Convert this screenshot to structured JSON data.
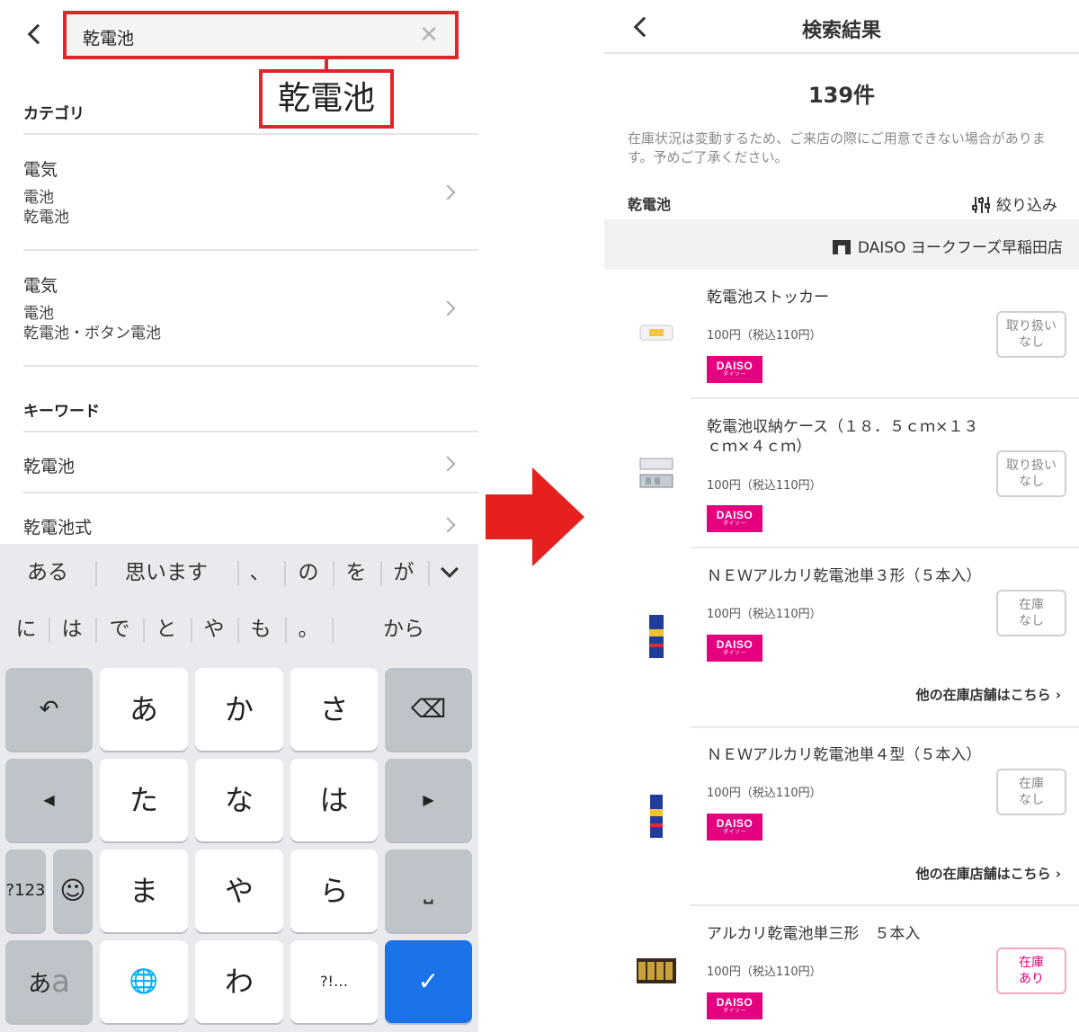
{
  "left": {
    "search": {
      "value": "乾電池",
      "clear_icon": "close-icon"
    },
    "callout_text": "乾電池",
    "category_label": "カテゴリ",
    "categories": [
      {
        "title": "電気",
        "sub1": "電池",
        "sub2": "乾電池"
      },
      {
        "title": "電気",
        "sub1": "電池",
        "sub2": "乾電池・ボタン電池"
      }
    ],
    "keyword_label": "キーワード",
    "keywords": [
      "乾電池",
      "乾電池式"
    ],
    "keyboard": {
      "suggestions_row1": [
        "ある",
        "思います",
        "、",
        "の",
        "を",
        "が"
      ],
      "suggestions_row2": [
        "に",
        "は",
        "で",
        "と",
        "や",
        "も",
        "。",
        "から"
      ],
      "keys": {
        "undo": "↶",
        "a": "あ",
        "ka": "か",
        "sa": "さ",
        "backspace": "⌫",
        "left": "◀",
        "ta": "た",
        "na": "な",
        "ha": "は",
        "right": "▶",
        "num": "?123",
        "emoji": "☺",
        "ma": "ま",
        "ya": "や",
        "ra": "ら",
        "space": "⎵",
        "mode_a": "あ",
        "mode_b": "a",
        "globe": "🌐",
        "wa": "わ",
        "punct": "?!…",
        "enter": "✓"
      }
    }
  },
  "right": {
    "title": "検索結果",
    "count": "139件",
    "notice": "在庫状況は変動するため、ご来店の際にご用意できない場合があります。予めご了承ください。",
    "term": "乾電池",
    "filter_label": "絞り込み",
    "store": "DAISO ヨークフーズ早稲田店",
    "brand": "DAISO",
    "brand_sub": "ダイソー",
    "other_stores": "他の在庫店舗はこちら",
    "products": [
      {
        "name": "乾電池ストッカー",
        "price": "100円（税込110円）",
        "stock": [
          "取り扱い",
          "なし"
        ],
        "available": false
      },
      {
        "name": "乾電池収納ケース（１８．５ｃｍ×１３ｃｍ×４ｃｍ）",
        "price": "100円（税込110円）",
        "stock": [
          "取り扱い",
          "なし"
        ],
        "available": false
      },
      {
        "name": "ＮＥＷアルカリ乾電池単３形（５本入）",
        "price": "100円（税込110円）",
        "stock": [
          "在庫",
          "なし"
        ],
        "available": false
      },
      {
        "name": "ＮＥＷアルカリ乾電池単４型（５本入）",
        "price": "100円（税込110円）",
        "stock": [
          "在庫",
          "なし"
        ],
        "available": false
      },
      {
        "name": "アルカリ乾電池単三形　５本入",
        "price": "100円（税込110円）",
        "stock": [
          "在庫",
          "あり"
        ],
        "available": true
      }
    ],
    "colors": {
      "accent": "#e5007f",
      "highlight": "#e1252a",
      "keyboard_enter": "#1a73e8"
    }
  }
}
